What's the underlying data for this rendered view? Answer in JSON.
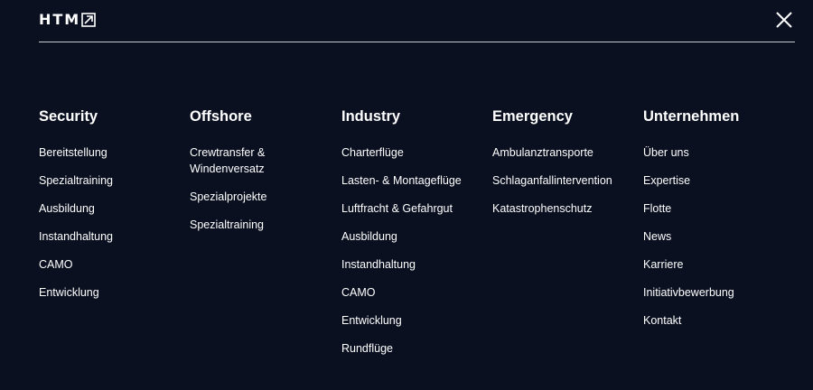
{
  "header": {
    "logo_text": "HTM",
    "logo_arrow_icon": "arrow-up-right-icon",
    "close_icon": "close-icon"
  },
  "menu": {
    "columns": [
      {
        "heading": "Security",
        "items": [
          "Bereitstellung",
          "Spezialtraining",
          "Ausbildung",
          "Instandhaltung",
          "CAMO",
          "Entwicklung"
        ]
      },
      {
        "heading": "Offshore",
        "items": [
          "Crewtransfer & Windenversatz",
          "Spezialprojekte",
          "Spezialtraining"
        ]
      },
      {
        "heading": "Industry",
        "items": [
          "Charterflüge",
          "Lasten- & Montageflüge",
          "Luftfracht & Gefahrgut",
          "Ausbildung",
          "Instandhaltung",
          "CAMO",
          "Entwicklung",
          "Rundflüge"
        ]
      },
      {
        "heading": "Emergency",
        "items": [
          "Ambulanztransporte",
          "Schlaganfallintervention",
          "Katastrophenschutz"
        ]
      },
      {
        "heading": "Unternehmen",
        "items": [
          "Über uns",
          "Expertise",
          "Flotte",
          "News",
          "Karriere",
          "Initiativbewerbung",
          "Kontakt"
        ]
      }
    ]
  },
  "colors": {
    "background": "#0a1020",
    "text": "#ffffff",
    "divider": "#c9ccd2"
  }
}
